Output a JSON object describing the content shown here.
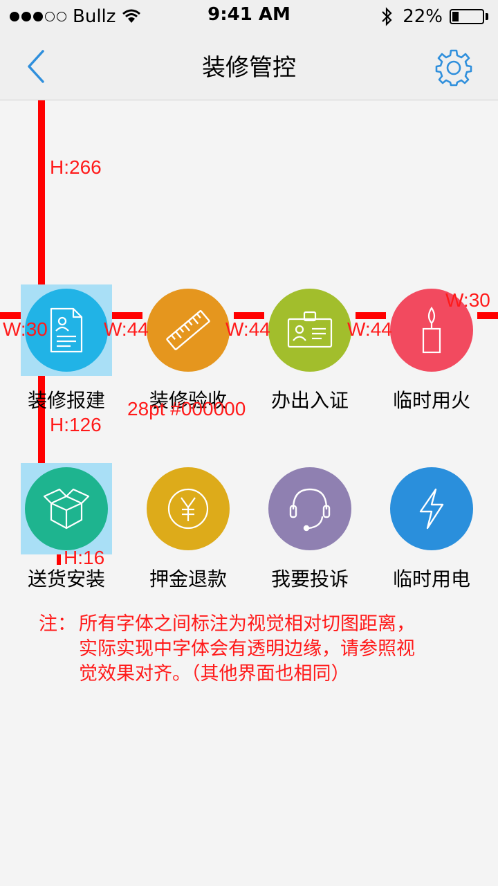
{
  "status_bar": {
    "carrier": "Bullz",
    "time": "9:41 AM",
    "battery_percent": "22%",
    "battery_level": 0.22,
    "signal_bars_filled": 3,
    "signal_bars_total": 5
  },
  "nav": {
    "title": "装修管控",
    "back_icon": "chevron-left-icon",
    "settings_icon": "gear-icon",
    "accent_color": "#2f8fdc"
  },
  "grid": {
    "row1": [
      {
        "label": "装修报建",
        "icon": "document-person-icon",
        "color": "#21b3e6"
      },
      {
        "label": "装修验收",
        "icon": "ruler-icon",
        "color": "#e5961e"
      },
      {
        "label": "办出入证",
        "icon": "id-badge-icon",
        "color": "#a2be2c"
      },
      {
        "label": "临时用火",
        "icon": "candle-icon",
        "color": "#f24a5f"
      }
    ],
    "row2": [
      {
        "label": "送货安装",
        "icon": "box-icon",
        "color": "#1eb48f"
      },
      {
        "label": "押金退款",
        "icon": "yen-icon",
        "color": "#ddab1a"
      },
      {
        "label": "我要投诉",
        "icon": "headset-icon",
        "color": "#8f80b1"
      },
      {
        "label": "临时用电",
        "icon": "lightning-icon",
        "color": "#2a8fdc"
      }
    ]
  },
  "annotations": {
    "h266": "H:266",
    "w30_left": "W:30",
    "w44_1": "W:44",
    "w44_2": "W:44",
    "w44_3": "W:44",
    "w30_right": "W:30",
    "font_spec": "28pt #000000",
    "h126": "H:126",
    "h16": "H:16",
    "color": "#ff1a1a"
  },
  "note": {
    "prefix": "注：",
    "line1": "所有字体之间标注为视觉相对切图距离，",
    "line2": "实际实现中字体会有透明边缘，请参照视",
    "line3": "觉效果对齐。（其他界面也相同）"
  }
}
